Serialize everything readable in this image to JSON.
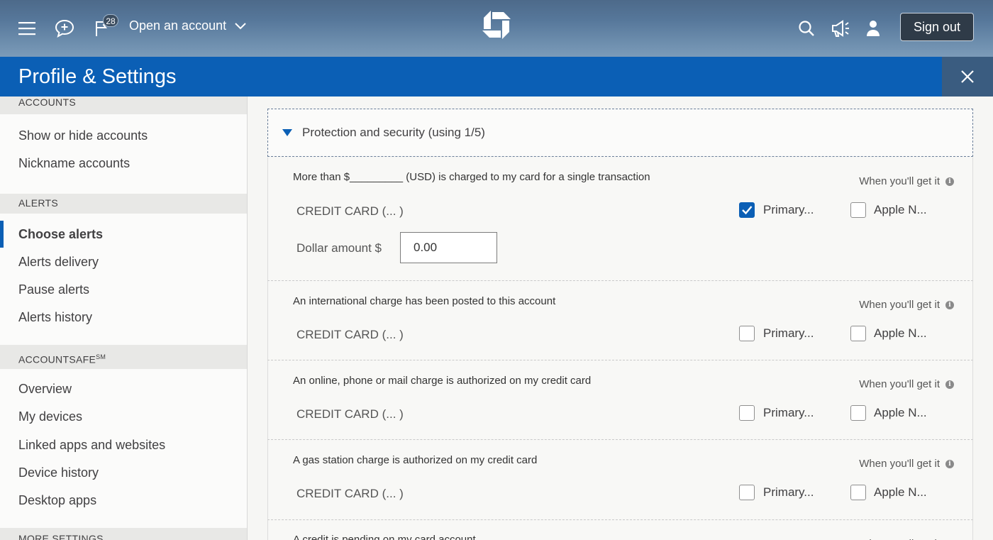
{
  "topbar": {
    "notification_count": "28",
    "open_account_label": "Open an account",
    "sign_out_label": "Sign out"
  },
  "header": {
    "title": "Profile & Settings"
  },
  "sidebar": {
    "sections": [
      {
        "label": "ACCOUNTS",
        "items": [
          "Show or hide accounts",
          "Nickname accounts"
        ]
      },
      {
        "label": "ALERTS",
        "items": [
          "Choose alerts",
          "Alerts delivery",
          "Pause alerts",
          "Alerts history"
        ]
      },
      {
        "label": "ACCOUNTSAFE",
        "sup": "SM",
        "items": [
          "Overview",
          "My devices",
          "Linked apps and websites",
          "Device history",
          "Desktop apps"
        ]
      },
      {
        "label": "MORE SETTINGS"
      }
    ],
    "active_item": "Choose alerts"
  },
  "main": {
    "accordion_label": "Protection and security (using 1/5)",
    "when_label": "When you'll get it",
    "card_label": "CREDIT CARD (...        )",
    "primary_label": "Primary...",
    "apple_label": "Apple N...",
    "dollar_label": "Dollar amount $",
    "dollar_value": "0.00",
    "alerts": [
      {
        "desc": "More than $_________ (USD) is charged to my card for a single transaction",
        "primary_checked": true,
        "apple_checked": false
      },
      {
        "desc": "An international charge has been posted to this account",
        "primary_checked": false,
        "apple_checked": false
      },
      {
        "desc": "An online, phone or mail charge is authorized on my credit card",
        "primary_checked": false,
        "apple_checked": false
      },
      {
        "desc": "A gas station charge is authorized on my credit card",
        "primary_checked": false,
        "apple_checked": false
      },
      {
        "desc": "A credit is pending on my card account"
      }
    ]
  },
  "colors": {
    "brand_blue": "#0b5fb5",
    "close_bg": "#3a5c80"
  },
  "icons": [
    "hamburger-icon",
    "chat-icon",
    "flag-icon",
    "chase-logo",
    "search-icon",
    "megaphone-icon",
    "person-icon",
    "close-icon",
    "info-icon",
    "checkmark-icon"
  ]
}
